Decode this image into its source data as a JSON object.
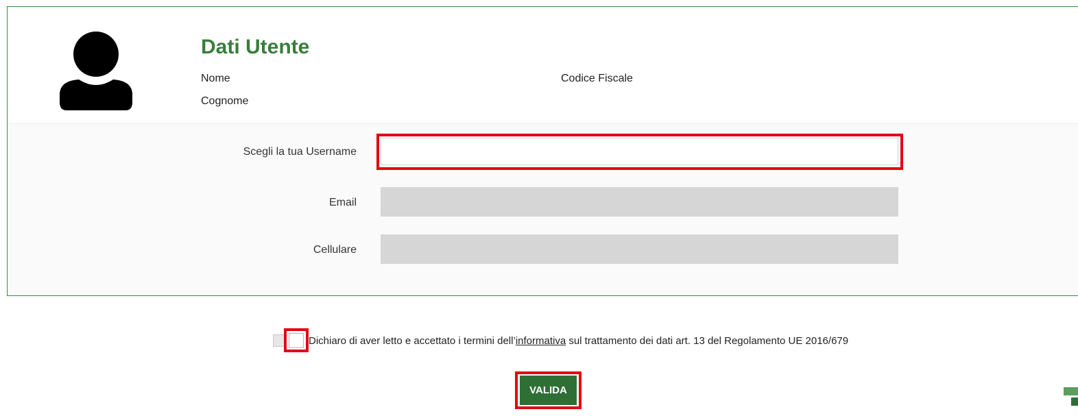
{
  "user_data": {
    "title": "Dati Utente",
    "nome_label": "Nome",
    "cognome_label": "Cognome",
    "codice_fiscale_label": "Codice Fiscale"
  },
  "form": {
    "username_label": "Scegli la tua Username",
    "username_value": "",
    "email_label": "Email",
    "email_value": "",
    "cellulare_label": "Cellulare",
    "cellulare_value": ""
  },
  "consent": {
    "text_before": "Dichiaro di aver letto e accettato i termini dell’",
    "link_text": "informativa",
    "text_after": " sul trattamento dei dati art. 13 del Regolamento UE 2016/679",
    "checked": false
  },
  "actions": {
    "submit_label": "VALIDA"
  },
  "icons": {
    "avatar": "user-silhouette-icon"
  },
  "colors": {
    "title_green": "#3a7d3c",
    "panel_border": "#3a8a3e",
    "button_green": "#2e6f36",
    "highlight_red": "#e30613",
    "disabled_field": "#d6d6d6"
  }
}
